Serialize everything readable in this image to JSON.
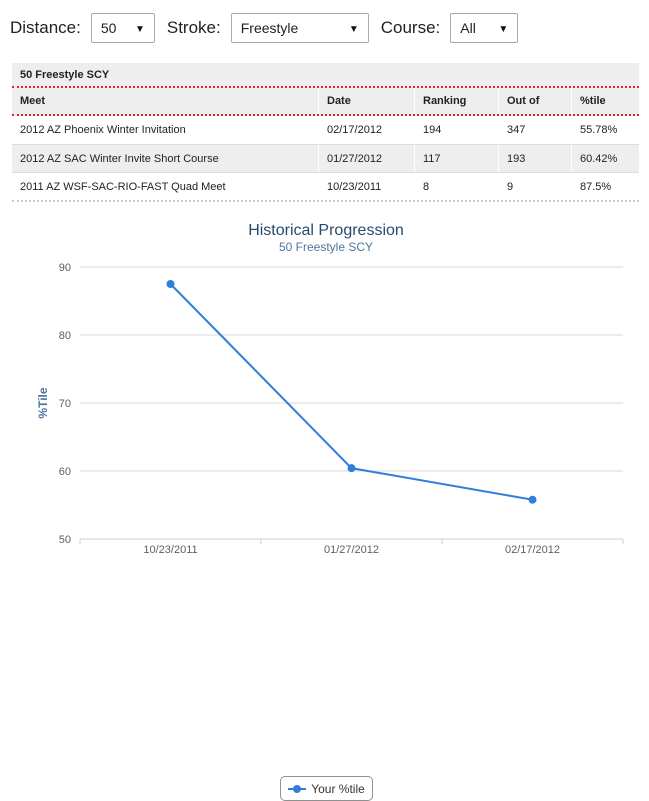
{
  "filters": {
    "distance": {
      "label": "Distance:",
      "value": "50"
    },
    "stroke": {
      "label": "Stroke:",
      "value": "Freestyle"
    },
    "course": {
      "label": "Course:",
      "value": "All"
    }
  },
  "table": {
    "caption": "50 Freestyle SCY",
    "columns": [
      "Meet",
      "Date",
      "Ranking",
      "Out of",
      "%tile"
    ],
    "rows": [
      {
        "meet": "2012 AZ Phoenix Winter Invitation",
        "date": "02/17/2012",
        "ranking": "194",
        "out_of": "347",
        "pct": "55.78%"
      },
      {
        "meet": "2012 AZ SAC Winter Invite Short Course",
        "date": "01/27/2012",
        "ranking": "117",
        "out_of": "193",
        "pct": "60.42%"
      },
      {
        "meet": "2011 AZ WSF-SAC-RIO-FAST Quad Meet",
        "date": "10/23/2011",
        "ranking": "8",
        "out_of": "9",
        "pct": "87.5%"
      }
    ]
  },
  "chart_data": {
    "type": "line",
    "title": "Historical Progression",
    "subtitle": "50 Freestyle SCY",
    "xlabel": "",
    "ylabel": "%Tile",
    "categories": [
      "10/23/2011",
      "01/27/2012",
      "02/17/2012"
    ],
    "series": [
      {
        "name": "Your %tile",
        "values": [
          87.5,
          60.42,
          55.78
        ]
      }
    ],
    "ylim": [
      50,
      90
    ],
    "yticks": [
      50,
      60,
      70,
      80,
      90
    ],
    "grid": true,
    "legend": "bottom-center",
    "color": "#2f7ed8"
  }
}
